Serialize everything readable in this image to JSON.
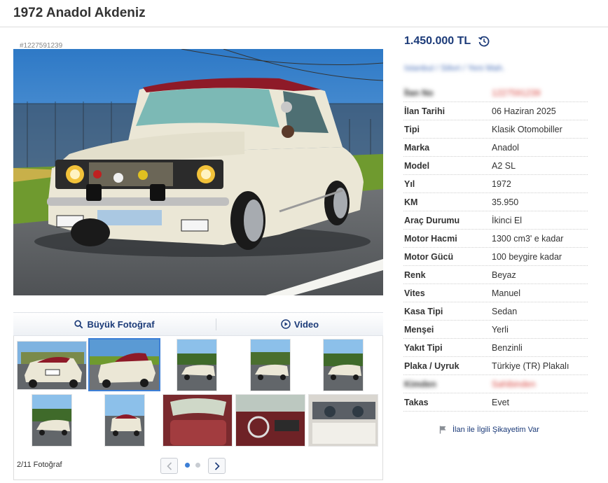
{
  "page_title": "1972 Anadol Akdeniz",
  "listing": {
    "id_label": "#1227591239",
    "price": "1.450.000 TL",
    "location": "Istanbul / Silivri / Yeni Mah."
  },
  "gallery": {
    "large_photo_label": "Büyük Fotoğraf",
    "video_label": "Video",
    "counter": "2/11 Fotoğraf",
    "selected_index": 2,
    "thumbnail_count": 10,
    "pages": 2,
    "current_page": 1
  },
  "attributes": [
    {
      "label": "İlan No",
      "value": "1227591239",
      "blurred": true
    },
    {
      "label": "İlan Tarihi",
      "value": "06 Haziran 2025"
    },
    {
      "label": "Tipi",
      "value": "Klasik Otomobiller"
    },
    {
      "label": "Marka",
      "value": "Anadol"
    },
    {
      "label": "Model",
      "value": "A2 SL"
    },
    {
      "label": "Yıl",
      "value": "1972"
    },
    {
      "label": "KM",
      "value": "35.950"
    },
    {
      "label": "Araç Durumu",
      "value": "İkinci El"
    },
    {
      "label": "Motor Hacmi",
      "value": "1300 cm3' e kadar"
    },
    {
      "label": "Motor Gücü",
      "value": "100 beygire kadar"
    },
    {
      "label": "Renk",
      "value": "Beyaz"
    },
    {
      "label": "Vites",
      "value": "Manuel"
    },
    {
      "label": "Kasa Tipi",
      "value": "Sedan"
    },
    {
      "label": "Menşei",
      "value": "Yerli"
    },
    {
      "label": "Yakıt Tipi",
      "value": "Benzinli"
    },
    {
      "label": "Plaka / Uyruk",
      "value": "Türkiye (TR) Plakalı"
    },
    {
      "label": "Kimden",
      "value": "Sahibinden",
      "blurred": true
    },
    {
      "label": "Takas",
      "value": "Evet"
    }
  ],
  "complaint_label": "İlan ile İlgili Şikayetim Var",
  "colors": {
    "brand_blue": "#1b3a78",
    "link_blue": "#4a70b8",
    "selected_border": "#3c7fd6",
    "car_body": "#ebe7d6",
    "car_roof": "#8e1a28"
  },
  "icons": {
    "price_history": "history-icon",
    "large_photo": "search-icon",
    "video": "play-icon",
    "complaint": "flag-icon"
  }
}
